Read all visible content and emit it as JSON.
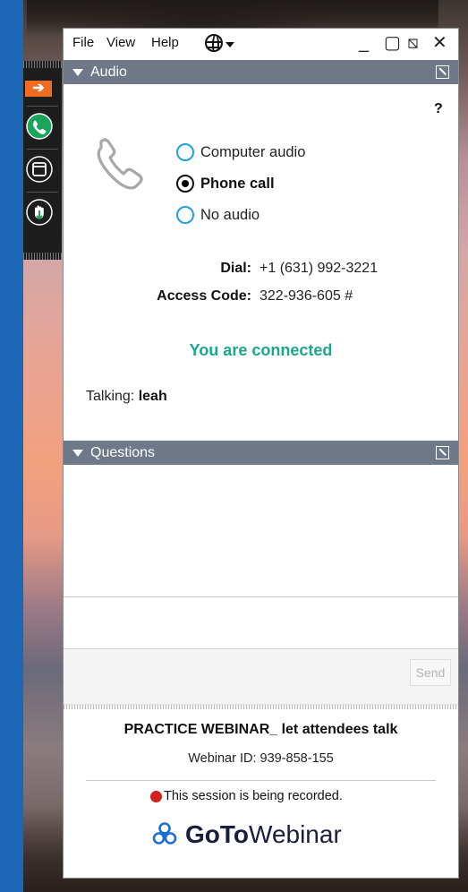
{
  "menu": {
    "file": "File",
    "view": "View",
    "help": "Help",
    "language_icon": "globe-icon",
    "window_controls": {
      "minimize": "_",
      "maximize": "▢",
      "restore": "⧅",
      "close": "✕"
    }
  },
  "dock": {
    "icons": [
      "arrow-right-icon",
      "phone-icon",
      "window-icon",
      "raise-hand-icon"
    ],
    "accent_color": "#f26b22"
  },
  "audio": {
    "section_title": "Audio",
    "help": "?",
    "options": [
      {
        "label": "Computer audio",
        "selected": false
      },
      {
        "label": "Phone call",
        "selected": true
      },
      {
        "label": "No audio",
        "selected": false
      }
    ],
    "dial_label": "Dial:",
    "dial_value": "+1 (631) 992-3221",
    "access_label": "Access Code:",
    "access_value": "322-936-605 #",
    "status": "You are connected",
    "talking_label": "Talking:",
    "talking_name": "leah",
    "status_color": "#18a98b"
  },
  "questions": {
    "section_title": "Questions",
    "send_label": "Send"
  },
  "footer": {
    "webinar_title": "PRACTICE WEBINAR_ let attendees talk",
    "webinar_id": "Webinar ID: 939-858-155",
    "recording": "This session is being recorded.",
    "logo_goto": "GoTo",
    "logo_webinar": "Webinar"
  }
}
